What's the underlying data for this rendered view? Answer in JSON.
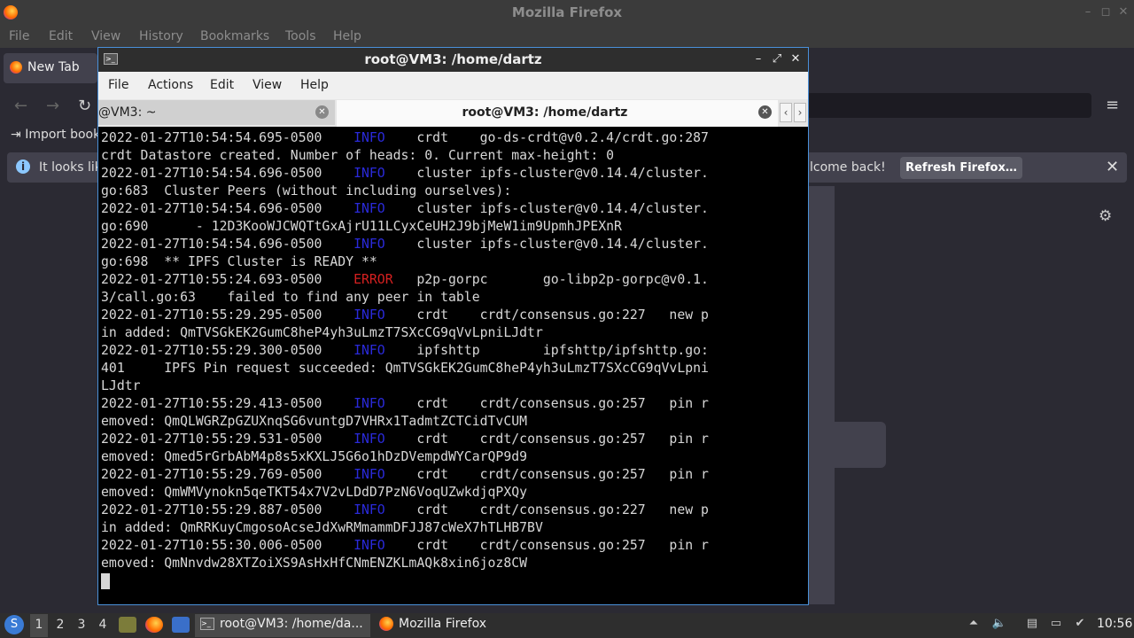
{
  "firefox": {
    "window_title": "Mozilla Firefox",
    "menu": [
      "File",
      "Edit",
      "View",
      "History",
      "Bookmarks",
      "Tools",
      "Help"
    ],
    "tab_label": "New Tab",
    "bookmarks_import": "Import book",
    "notice_left": "It looks lik",
    "notice_right": "lcome back!",
    "refresh_button": "Refresh Firefox…"
  },
  "terminal": {
    "window_title": "root@VM3: /home/dartz",
    "menu": [
      "File",
      "Actions",
      "Edit",
      "View",
      "Help"
    ],
    "tabs": [
      {
        "label": "@VM3: ~"
      },
      {
        "label": "root@VM3: /home/dartz"
      }
    ],
    "lines": [
      {
        "pre": "2022-01-27T10:54:54.695-0500    ",
        "lvl": "INFO",
        "post": "    crdt    go-ds-crdt@v0.2.4/crdt.go:287"
      },
      {
        "text": "crdt Datastore created. Number of heads: 0. Current max-height: 0"
      },
      {
        "pre": "2022-01-27T10:54:54.696-0500    ",
        "lvl": "INFO",
        "post": "    cluster ipfs-cluster@v0.14.4/cluster."
      },
      {
        "text": "go:683  Cluster Peers (without including ourselves):"
      },
      {
        "pre": "2022-01-27T10:54:54.696-0500    ",
        "lvl": "INFO",
        "post": "    cluster ipfs-cluster@v0.14.4/cluster."
      },
      {
        "text": "go:690      - 12D3KooWJCWQTtGxAjrU11LCyxCeUH2J9bjMeW1im9UpmhJPEXnR"
      },
      {
        "pre": "2022-01-27T10:54:54.696-0500    ",
        "lvl": "INFO",
        "post": "    cluster ipfs-cluster@v0.14.4/cluster."
      },
      {
        "text": "go:698  ** IPFS Cluster is READY **"
      },
      {
        "pre": "2022-01-27T10:55:24.693-0500    ",
        "lvl": "ERROR",
        "error": true,
        "post": "   p2p-gorpc       go-libp2p-gorpc@v0.1."
      },
      {
        "text": "3/call.go:63    failed to find any peer in table"
      },
      {
        "pre": "2022-01-27T10:55:29.295-0500    ",
        "lvl": "INFO",
        "post": "    crdt    crdt/consensus.go:227   new p"
      },
      {
        "text": "in added: QmTVSGkEK2GumC8heP4yh3uLmzT7SXcCG9qVvLpniLJdtr"
      },
      {
        "pre": "2022-01-27T10:55:29.300-0500    ",
        "lvl": "INFO",
        "post": "    ipfshttp        ipfshttp/ipfshttp.go:"
      },
      {
        "text": "401     IPFS Pin request succeeded: QmTVSGkEK2GumC8heP4yh3uLmzT7SXcCG9qVvLpni"
      },
      {
        "text": "LJdtr"
      },
      {
        "pre": "2022-01-27T10:55:29.413-0500    ",
        "lvl": "INFO",
        "post": "    crdt    crdt/consensus.go:257   pin r"
      },
      {
        "text": "emoved: QmQLWGRZpGZUXnqSG6vuntgD7VHRx1TadmtZCTCidTvCUM"
      },
      {
        "pre": "2022-01-27T10:55:29.531-0500    ",
        "lvl": "INFO",
        "post": "    crdt    crdt/consensus.go:257   pin r"
      },
      {
        "text": "emoved: Qmed5rGrbAbM4p8s5xKXLJ5G6o1hDzDVempdWYCarQP9d9"
      },
      {
        "pre": "2022-01-27T10:55:29.769-0500    ",
        "lvl": "INFO",
        "post": "    crdt    crdt/consensus.go:257   pin r"
      },
      {
        "text": "emoved: QmWMVynokn5qeTKT54x7V2vLDdD7PzN6VoqUZwkdjqPXQy"
      },
      {
        "pre": "2022-01-27T10:55:29.887-0500    ",
        "lvl": "INFO",
        "post": "    crdt    crdt/consensus.go:227   new p"
      },
      {
        "text": "in added: QmRRKuyCmgosoAcseJdXwRMmammDFJJ87cWeX7hTLHB7BV"
      },
      {
        "pre": "2022-01-27T10:55:30.006-0500    ",
        "lvl": "INFO",
        "post": "    crdt    crdt/consensus.go:257   pin r"
      },
      {
        "text": "emoved: QmNnvdw28XTZoiXS9AsHxHfCNmENZKLmAQk8xin6joz8CW"
      }
    ]
  },
  "taskbar": {
    "workspaces": [
      "1",
      "2",
      "3",
      "4"
    ],
    "task_terminal": "root@VM3: /home/da...",
    "task_firefox": "Mozilla Firefox",
    "clock": "10:56"
  }
}
